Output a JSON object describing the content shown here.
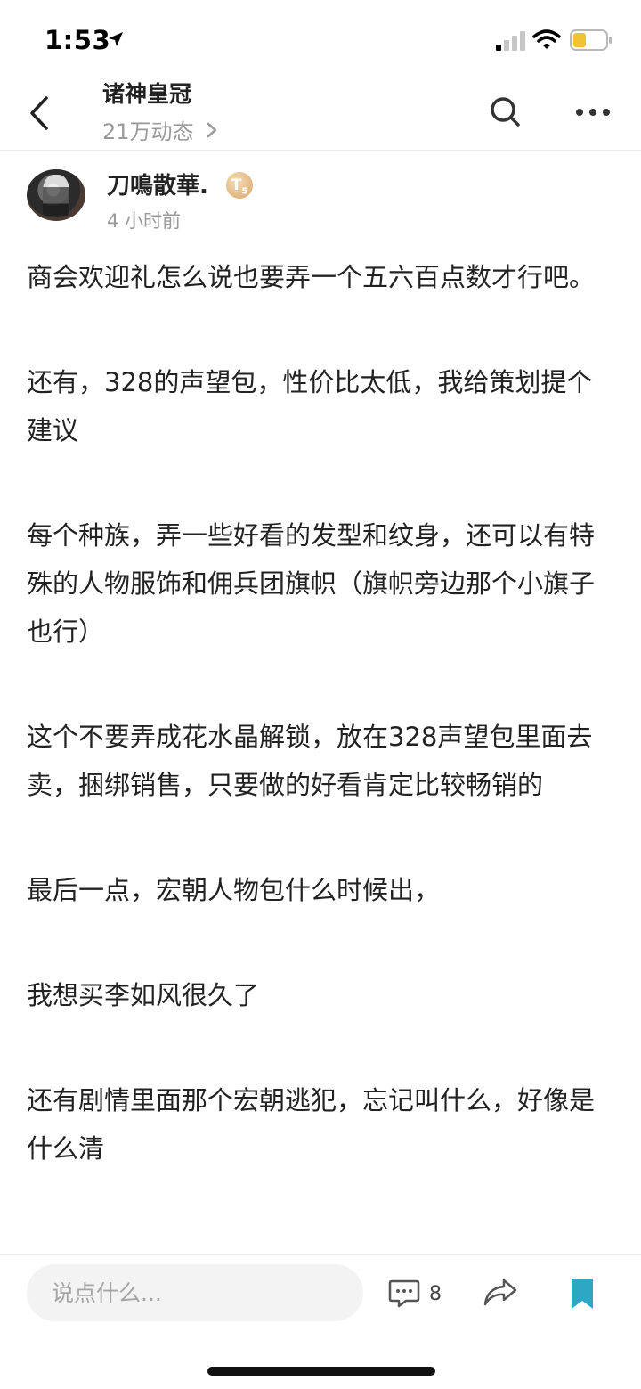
{
  "status_bar": {
    "time": "1:53"
  },
  "header": {
    "title": "诸神皇冠",
    "subtitle": "21万动态"
  },
  "post": {
    "author": "刀鳴散華.",
    "badge": "T",
    "badge_level": "5",
    "time": "4 小时前",
    "paragraphs": [
      "商会欢迎礼怎么说也要弄一个五六百点数才行吧。",
      "还有，328的声望包，性价比太低，我给策划提个建议",
      "每个种族，弄一些好看的发型和纹身，还可以有特殊的人物服饰和佣兵团旗帜（旗帜旁边那个小旗子也行）",
      "这个不要弄成花水晶解锁，放在328声望包里面去卖，捆绑销售，只要做的好看肯定比较畅销的",
      "最后一点，宏朝人物包什么时候出，",
      "我想买李如风很久了",
      "还有剧情里面那个宏朝逃犯，忘记叫什么，好像是什么清"
    ]
  },
  "bottom_bar": {
    "comment_placeholder": "说点什么...",
    "comment_count": "8"
  },
  "colors": {
    "accent": "#2ea7c4",
    "muted": "#9a9a9a",
    "input_bg": "#f3f3f3"
  }
}
